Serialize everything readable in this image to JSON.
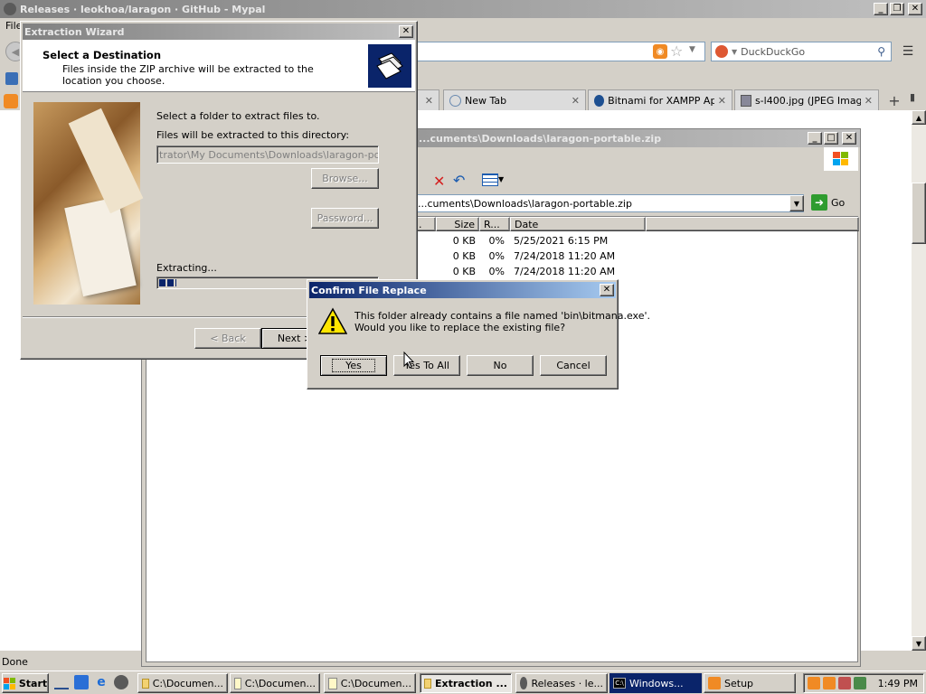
{
  "browser": {
    "title": "Releases · leokhoa/laragon · GitHub - Mypal",
    "menu_file": "File",
    "search_placeholder": "DuckDuckGo",
    "tabs": [
      {
        "label": ""
      },
      {
        "label": "New Tab"
      },
      {
        "label": "Bitnami for XAMPP App..."
      },
      {
        "label": "s-l400.jpg (JPEG Imag..."
      }
    ],
    "status": "Done"
  },
  "explorer": {
    "title": "...cuments\\Downloads\\laragon-portable.zip",
    "address": "...cuments\\Downloads\\laragon-portable.zip",
    "go_label": "Go",
    "columns": [
      ".",
      "Size",
      "R...",
      "Date"
    ],
    "rows": [
      {
        "size": "0 KB",
        "ratio": "0%",
        "date": "5/25/2021 6:15 PM"
      },
      {
        "size": "0 KB",
        "ratio": "0%",
        "date": "7/24/2018 11:20 AM"
      },
      {
        "size": "0 KB",
        "ratio": "0%",
        "date": "7/24/2018 11:20 AM"
      }
    ]
  },
  "wizard": {
    "title": "Extraction Wizard",
    "heading": "Select a Destination",
    "subheading": "Files inside the ZIP archive will be extracted to the location you choose.",
    "select_label": "Select a folder to extract files to.",
    "dir_label": "Files will be extracted to this directory:",
    "dir_value": "trator\\My Documents\\Downloads\\laragon-portable",
    "browse_label": "Browse...",
    "password_label": "Password...",
    "extracting_label": "Extracting...",
    "progress": 0.08,
    "back_label": "< Back",
    "next_label": "Next >"
  },
  "confirm": {
    "title": "Confirm File Replace",
    "message_line1": "This folder already contains a file named 'bin\\bitmana.exe'.",
    "message_line2": "Would you like to replace the existing file?",
    "yes_label": "Yes",
    "yes_all_label": "Yes To All",
    "no_label": "No",
    "cancel_label": "Cancel"
  },
  "taskbar": {
    "start_label": "Start",
    "items": [
      {
        "label": "C:\\Documen...",
        "active": false
      },
      {
        "label": "C:\\Documen...",
        "active": false
      },
      {
        "label": "C:\\Documen...",
        "active": false
      },
      {
        "label": "Extraction ...",
        "active": true
      },
      {
        "label": "Releases · le...",
        "active": false
      },
      {
        "label": "Windows...",
        "active": false
      },
      {
        "label": "Setup",
        "active": false
      }
    ],
    "clock": "1:49 PM"
  },
  "colors": {
    "titlebar_active_start": "#0a246a",
    "titlebar_active_end": "#a6caf0",
    "titlebar_inactive_start": "#808080",
    "titlebar_inactive_end": "#c0c0c0",
    "face": "#d4d0c8"
  }
}
